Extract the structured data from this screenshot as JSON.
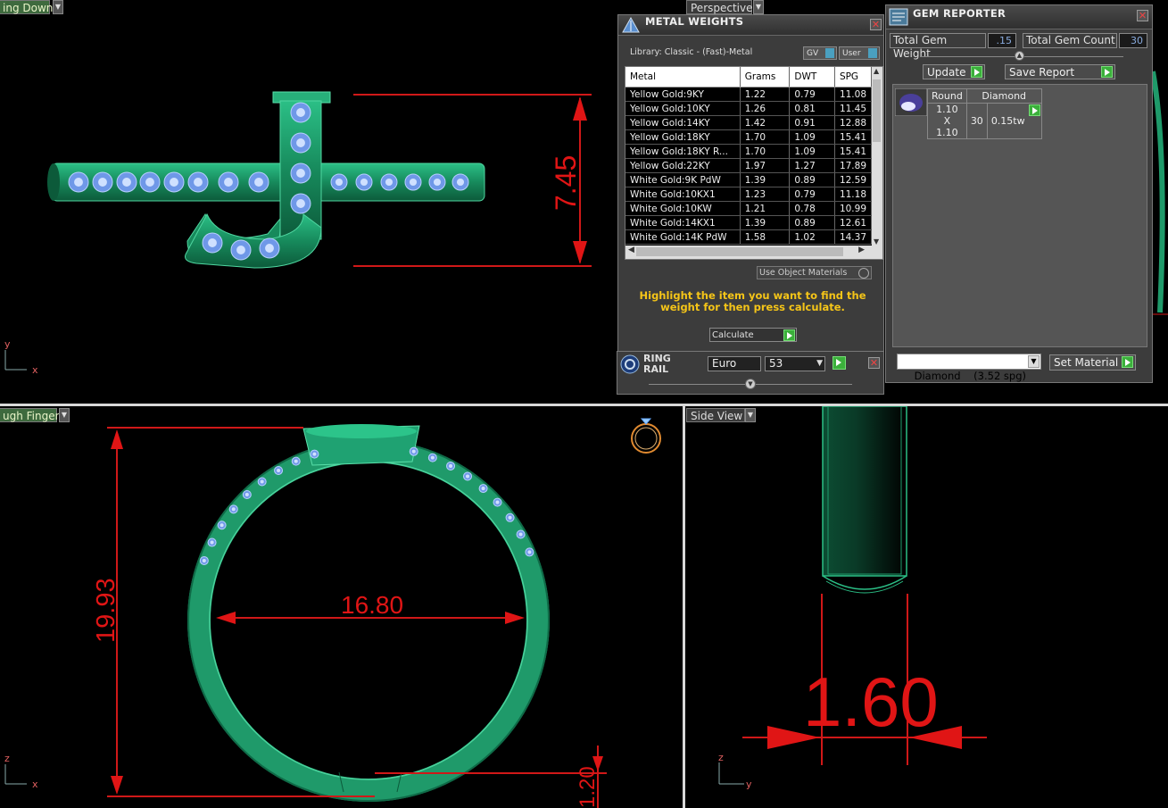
{
  "viewports": {
    "top_left": {
      "label": "ing Down"
    },
    "top_right": {
      "label": "Perspective"
    },
    "bottom_left": {
      "label": "ugh Finger"
    },
    "bottom_right": {
      "label": "Side View"
    }
  },
  "axes": {
    "top_left": {
      "v": "y",
      "h": "x"
    },
    "bottom_left": {
      "v": "z",
      "h": "x"
    },
    "bottom_right": {
      "v": "z",
      "h": "y"
    }
  },
  "dimensions": {
    "height": "7.45",
    "ring_outer": "19.93",
    "ring_inner": "16.80",
    "shank_bottom": "1.20",
    "side_width": "1.60"
  },
  "metal_weights": {
    "title": "METAL WEIGHTS",
    "library": "Library: Classic - (Fast)-Metal",
    "gv_label": "GV",
    "user_label": "User",
    "columns": [
      "Metal",
      "Grams",
      "DWT",
      "SPG"
    ],
    "rows": [
      [
        "Yellow Gold:9KY",
        "1.22",
        "0.79",
        "11.08"
      ],
      [
        "Yellow Gold:10KY",
        "1.26",
        "0.81",
        "11.45"
      ],
      [
        "Yellow Gold:14KY",
        "1.42",
        "0.91",
        "12.88"
      ],
      [
        "Yellow Gold:18KY",
        "1.70",
        "1.09",
        "15.41"
      ],
      [
        "Yellow Gold:18KY R...",
        "1.70",
        "1.09",
        "15.41"
      ],
      [
        "Yellow Gold:22KY",
        "1.97",
        "1.27",
        "17.89"
      ],
      [
        "White Gold:9K PdW",
        "1.39",
        "0.89",
        "12.59"
      ],
      [
        "White Gold:10KX1",
        "1.23",
        "0.79",
        "11.18"
      ],
      [
        "White Gold:10KW",
        "1.21",
        "0.78",
        "10.99"
      ],
      [
        "White Gold:14KX1",
        "1.39",
        "0.89",
        "12.61"
      ],
      [
        "White Gold:14K PdW",
        "1.58",
        "1.02",
        "14.37"
      ]
    ],
    "use_object_materials": "Use Object Materials",
    "hint": "Highlight the item you want to find the weight for then press calculate.",
    "calculate": "Calculate"
  },
  "ring_rail": {
    "title": "RING RAIL",
    "standard": "Euro",
    "size": "53"
  },
  "gem_reporter": {
    "title": "GEM REPORTER",
    "total_weight_label": "Total Gem Weight",
    "total_weight": ".15",
    "total_count_label": "Total Gem Count",
    "total_count": "30",
    "update": "Update",
    "save_report": "Save Report",
    "gem": {
      "shape": "Round",
      "material": "Diamond",
      "size": "1.10 X 1.10",
      "count": "30",
      "weight": "0.15tw"
    },
    "material_select": "Diamond    (3.52 spg)",
    "set_material": "Set Material"
  },
  "colors": {
    "model_green": "#1f9a6a",
    "gem_blue": "#7fa8f0",
    "dim_red": "#e01515",
    "hint_yellow": "#f5c518"
  }
}
